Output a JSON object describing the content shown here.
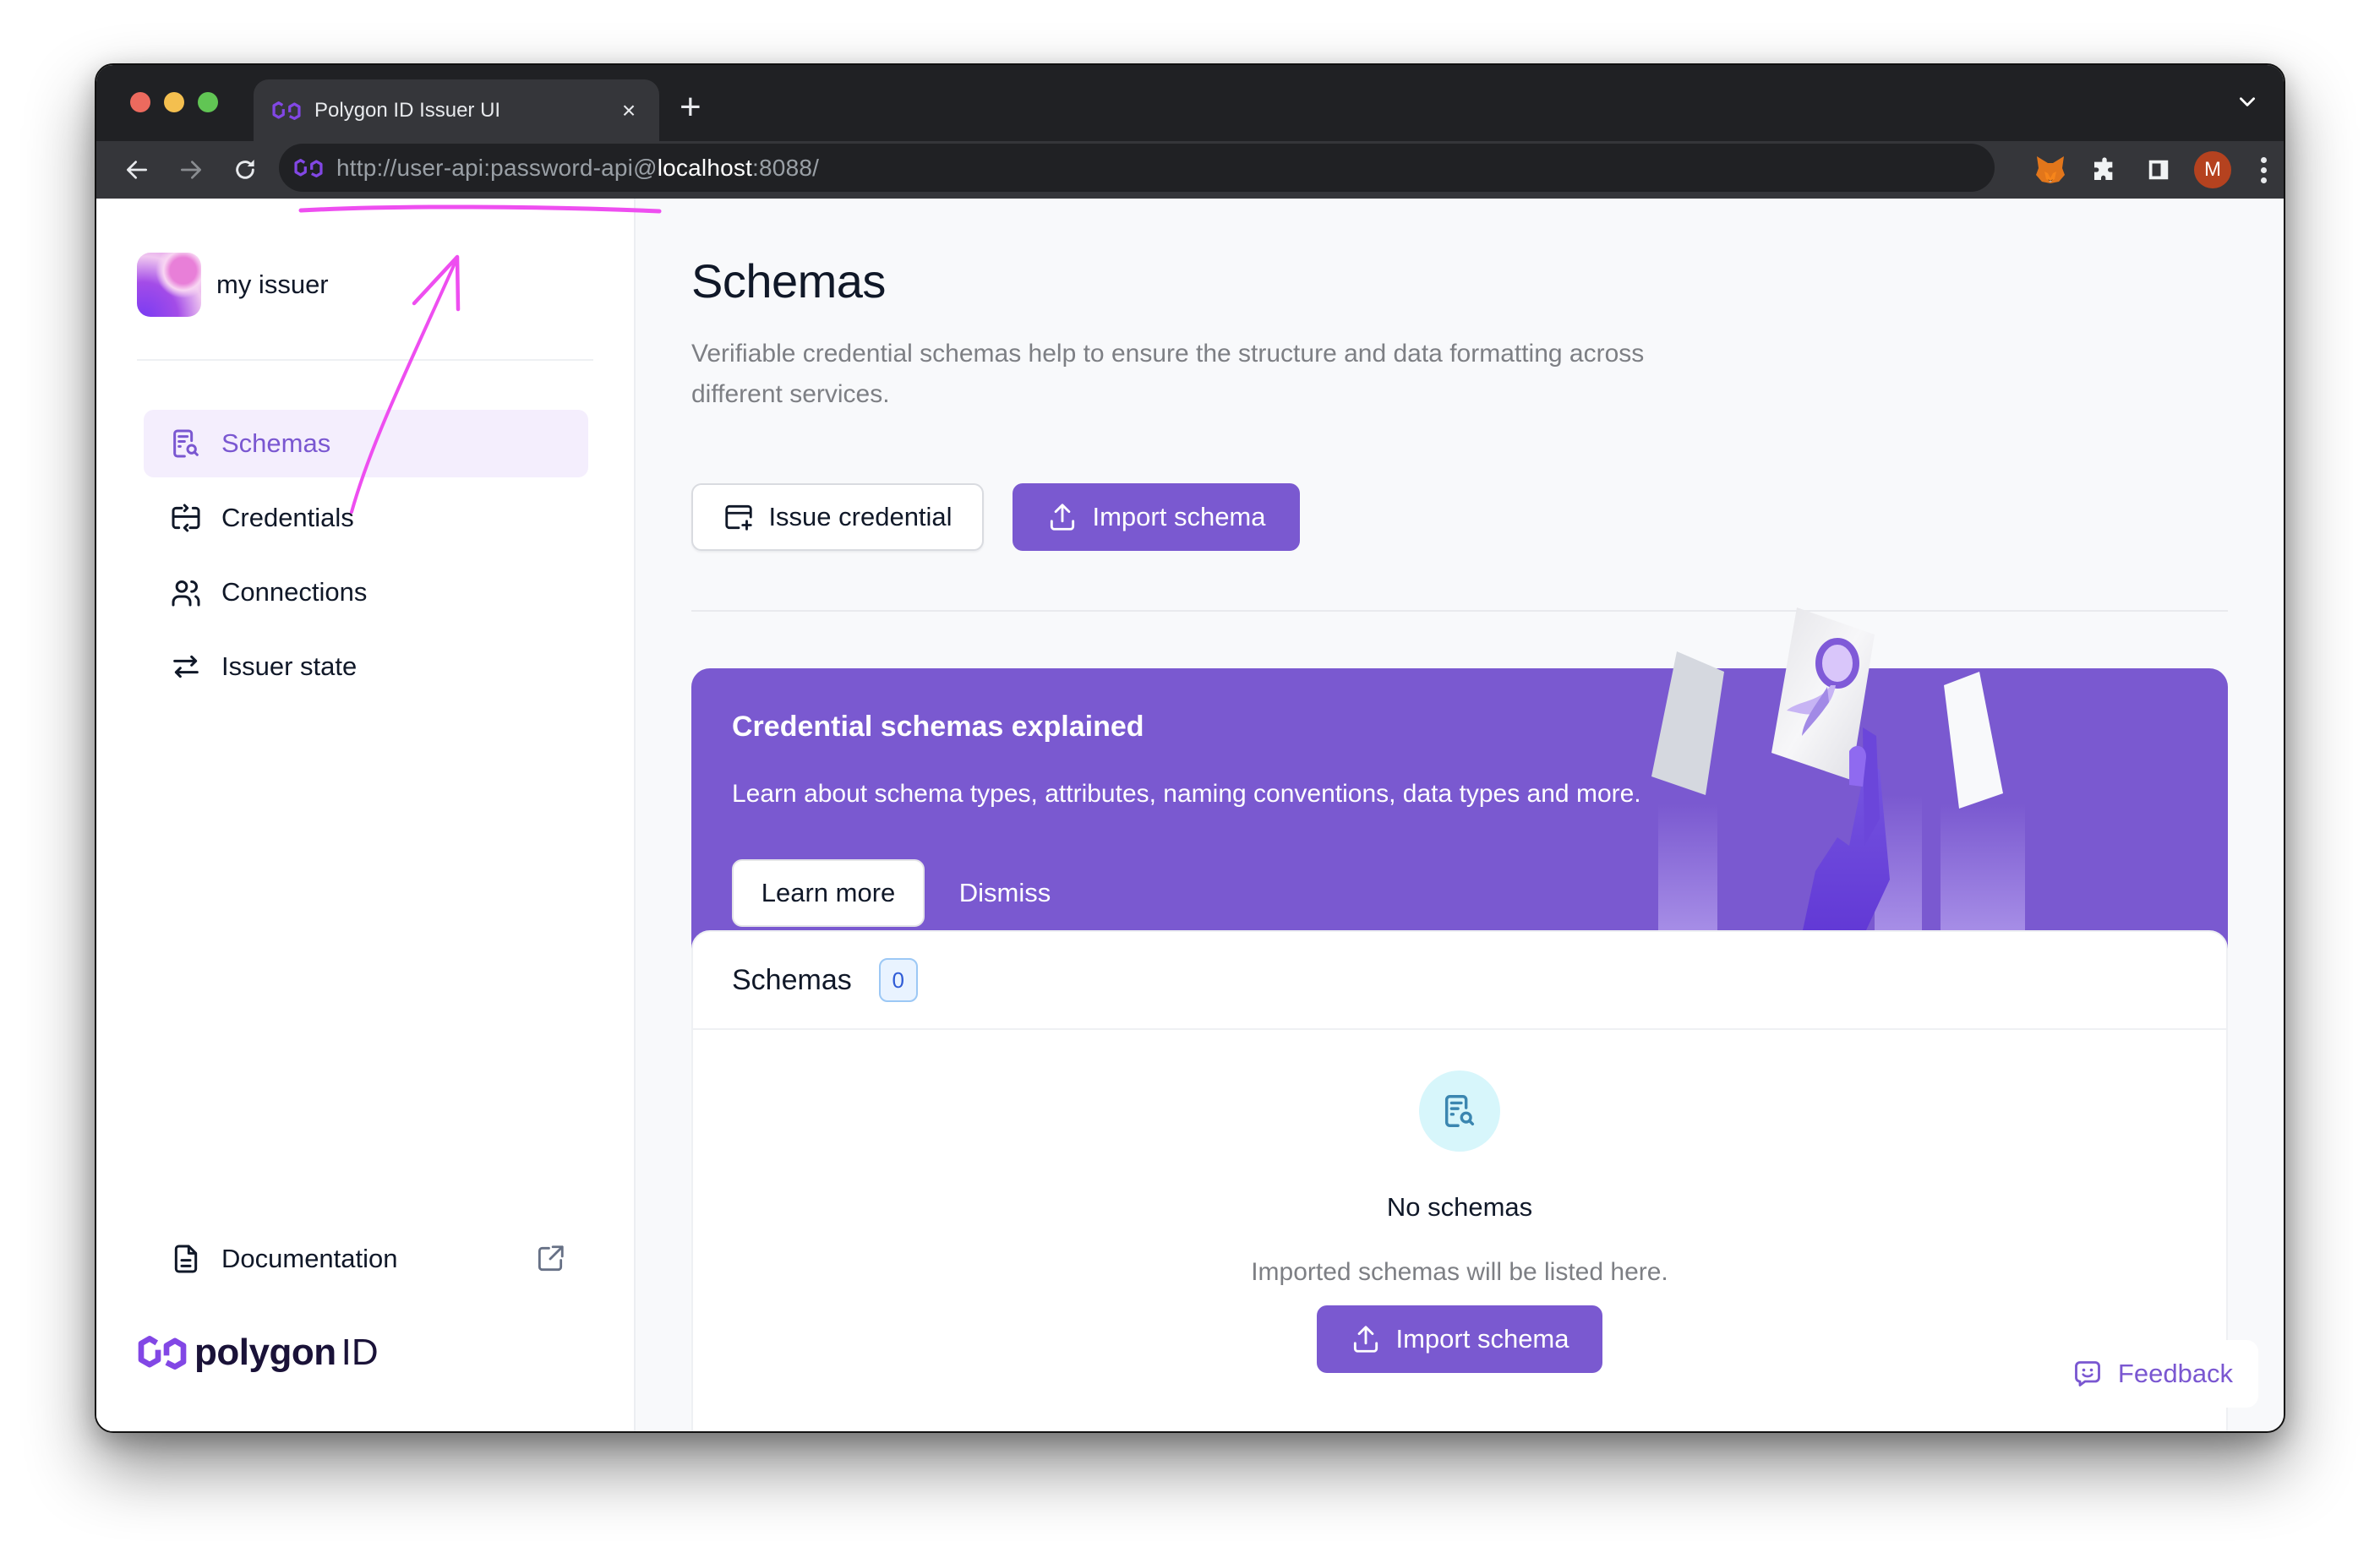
{
  "browser": {
    "tab": {
      "title": "Polygon ID Issuer UI",
      "close_glyph": "×",
      "favicon": "polygon-logo-icon"
    },
    "new_tab_glyph": "+",
    "nav": {
      "back": "arrow-left-icon",
      "forward": "arrow-right-icon",
      "reload": "reload-icon"
    },
    "url": {
      "prefix": "http://user-api:password-api@",
      "host": "localhost",
      "suffix": ":8088/"
    },
    "extensions": [
      "metamask-fox-icon",
      "puzzle-icon",
      "sidepanel-icon"
    ],
    "profile_initial": "M",
    "profile_color": "#b5421f"
  },
  "sidebar": {
    "issuer_name": "my issuer",
    "items": [
      {
        "label": "Schemas",
        "icon": "schema-search-icon",
        "active": true
      },
      {
        "label": "Credentials",
        "icon": "credentials-swap-icon",
        "active": false
      },
      {
        "label": "Connections",
        "icon": "users-icon",
        "active": false
      },
      {
        "label": "Issuer state",
        "icon": "arrows-exchange-icon",
        "active": false
      }
    ],
    "documentation": {
      "label": "Documentation",
      "icon": "document-icon",
      "external_icon": "external-link-icon"
    },
    "brand": {
      "word": "polygon",
      "suffix": "ID"
    }
  },
  "main": {
    "title": "Schemas",
    "description": "Verifiable credential schemas help to ensure the structure and data formatting across different services.",
    "actions": {
      "issue_credential": "Issue credential",
      "import_schema": "Import schema"
    },
    "banner": {
      "title": "Credential schemas explained",
      "text": "Learn about schema types, attributes, naming conventions, data types and more.",
      "learn_more": "Learn more",
      "dismiss": "Dismiss"
    },
    "schemas_card": {
      "title": "Schemas",
      "count": "0",
      "empty_title": "No schemas",
      "empty_subtitle": "Imported schemas will be listed here.",
      "import_button": "Import schema"
    },
    "feedback": "Feedback"
  },
  "colors": {
    "accent": "#7a59d0",
    "accent_text": "#7a57d1",
    "active_nav_bg": "#f4eefd",
    "annotation": "#ee4ef0",
    "badge_bg": "#e9f3ff",
    "badge_text": "#2f5bd6",
    "empty_icon_bg": "#d7f6fb"
  }
}
